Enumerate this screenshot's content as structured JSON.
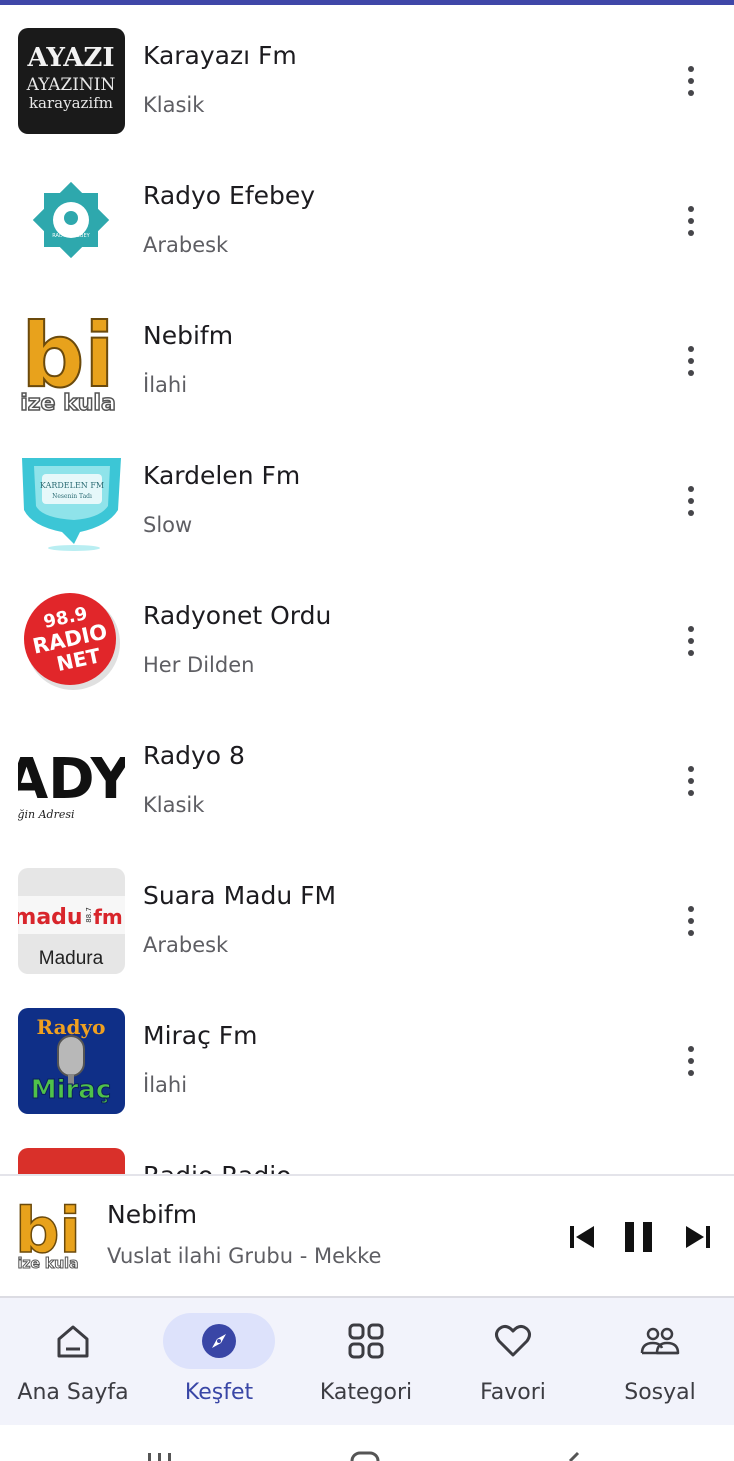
{
  "colors": {
    "accent": "#3946a6",
    "top_bar": "#3f47a8",
    "nav_bg": "#f2f3fb",
    "nav_active_pill": "#dde2fb"
  },
  "stations": [
    {
      "name": "Karayazı Fm",
      "genre": "Klasik",
      "logo": "karayazi-logo",
      "logo_text": [
        "AYAZI",
        "AYAZININ",
        "karayazifm"
      ]
    },
    {
      "name": "Radyo Efebey",
      "genre": "Arabesk",
      "logo": "radyo-efebey-logo",
      "logo_text": [
        "RADYO EFEBEY"
      ]
    },
    {
      "name": "Nebifm",
      "genre": "İlahi",
      "logo": "nebifm-logo",
      "logo_text": [
        "bi",
        "ize kula"
      ]
    },
    {
      "name": "Kardelen Fm",
      "genre": "Slow",
      "logo": "kardelen-logo",
      "logo_text": [
        "KARDELEN FM",
        "Nesenin Tadı"
      ]
    },
    {
      "name": "Radyonet Ordu",
      "genre": "Her Dilden",
      "logo": "radyonet-logo",
      "logo_text": [
        "98.9",
        "RADIO",
        "NET"
      ]
    },
    {
      "name": "Radyo 8",
      "genre": "Klasik",
      "logo": "radyo8-logo",
      "logo_text": [
        "ADY",
        "ğin Adresi"
      ]
    },
    {
      "name": "Suara Madu FM",
      "genre": "Arabesk",
      "logo": "madu-fm-logo",
      "logo_text": [
        "madu",
        "fm",
        "88.7",
        "Madura"
      ]
    },
    {
      "name": "Miraç Fm",
      "genre": "İlahi",
      "logo": "mirac-logo",
      "logo_text": [
        "Radyo",
        "Miraç"
      ]
    },
    {
      "name": "Radio Radio",
      "genre": "",
      "logo": "radio-radio-logo",
      "logo_text": []
    }
  ],
  "player": {
    "title": "Nebifm",
    "subtitle": "Vuslat ilahi Grubu - Mekke",
    "logo_text": [
      "bi",
      "ize kula"
    ],
    "state": "playing"
  },
  "nav": [
    {
      "label": "Ana Sayfa",
      "icon": "home-icon",
      "active": false
    },
    {
      "label": "Keşfet",
      "icon": "compass-icon",
      "active": true
    },
    {
      "label": "Kategori",
      "icon": "grid-icon",
      "active": false
    },
    {
      "label": "Favori",
      "icon": "heart-icon",
      "active": false
    },
    {
      "label": "Sosyal",
      "icon": "people-icon",
      "active": false
    }
  ]
}
